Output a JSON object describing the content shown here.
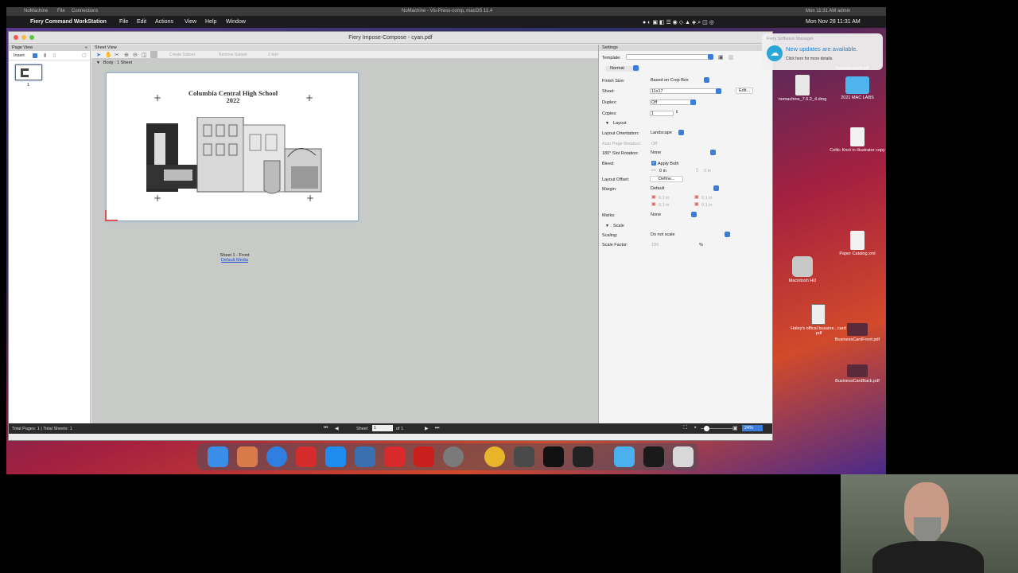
{
  "nomachine": {
    "app": "NoMachine",
    "menu_file": "File",
    "menu_connections": "Connections",
    "session_title": "NoMachine - Vis-Press-comp, macOS 11.4",
    "status_right": "Mon 11:31 AM    admin"
  },
  "mac_menubar": {
    "app_name": "Fiery Command WorkStation",
    "menus": [
      "File",
      "Edit",
      "Actions",
      "View",
      "Help",
      "Window"
    ],
    "clock": "Mon Nov 28  11:31 AM"
  },
  "window": {
    "title": "Fiery Impose-Compose - cyan.pdf"
  },
  "page_view": {
    "header": "Page View",
    "insert_label": "Insert",
    "thumb_number": "1"
  },
  "sheet_view": {
    "header": "Sheet View",
    "toolbar": {
      "create_subset": "Create Subset",
      "remove_subset": "Remove Subset",
      "z_fold": "Z-fold"
    },
    "body_label": "Body : 1 Sheet",
    "sheet_title_line1": "Columbia Central High School",
    "sheet_title_line2": "2022",
    "sheet_caption": "Sheet 1 - Front",
    "media_link": "Default Media"
  },
  "settings": {
    "header": "Settings",
    "template_label": "Template:",
    "mode": "Normal",
    "finish_size_label": "Finish Size:",
    "finish_size": "Based on Crop Box",
    "sheet_label": "Sheet:",
    "sheet": "11x17",
    "edit_button": "Edit...",
    "duplex_label": "Duplex:",
    "duplex": "Off",
    "copies_label": "Copies:",
    "copies": "1",
    "layout_section": "Layout",
    "orientation_label": "Layout Orientation:",
    "orientation": "Landscape",
    "auto_rotation_label": "Auto Page Rotation:",
    "auto_rotation": "Off",
    "slot_rotation_label": "180° Slot Rotation:",
    "slot_rotation": "None",
    "bleed_label": "Bleed:",
    "apply_both": "Apply Both",
    "bleed_value": "0 in",
    "bleed_value2": "0 in",
    "layout_offset_label": "Layout Offset:",
    "define_button": "Define...",
    "margin_label": "Margin:",
    "margin": "Default",
    "margin_values": [
      "0.1 in",
      "0.1 in",
      "0.1 in",
      "0.1 in"
    ],
    "marks_label": "Marks:",
    "marks": "None",
    "scale_section": "Scale",
    "scaling_label": "Scaling:",
    "scaling": "Do not scale",
    "scale_factor_label": "Scale Factor:",
    "scale_factor": "100",
    "percent": "%"
  },
  "statusbar": {
    "totals": "Total Pages: 1 | Total Sheets: 1",
    "sheet_label": "Sheet",
    "sheet_num": "1",
    "of_label": "of 1",
    "zoom": "24%"
  },
  "notification": {
    "app": "Fiery Software Manager",
    "title": "New updates are available.",
    "body": "Click here for more details."
  },
  "desktop": {
    "icons": [
      {
        "label": "nomachine_7.6.2_4.dmg"
      },
      {
        "label": "2021 MAC LABS"
      },
      {
        "label": "Celtic Knot in illustrator copy"
      },
      {
        "label": "Paper Catalog.xml"
      },
      {
        "label": "Macintosh HD"
      },
      {
        "label": "Haley's offical bussine...card .pdf"
      },
      {
        "label": "BusinessCardFront.pdf"
      },
      {
        "label": "BusinessCardBack.pdf"
      }
    ],
    "partial_label": "business cards.pdf"
  },
  "colors": {
    "accent": "#3b7dd8",
    "link": "#1a4fd8",
    "desktop_red": "#c2203a"
  }
}
